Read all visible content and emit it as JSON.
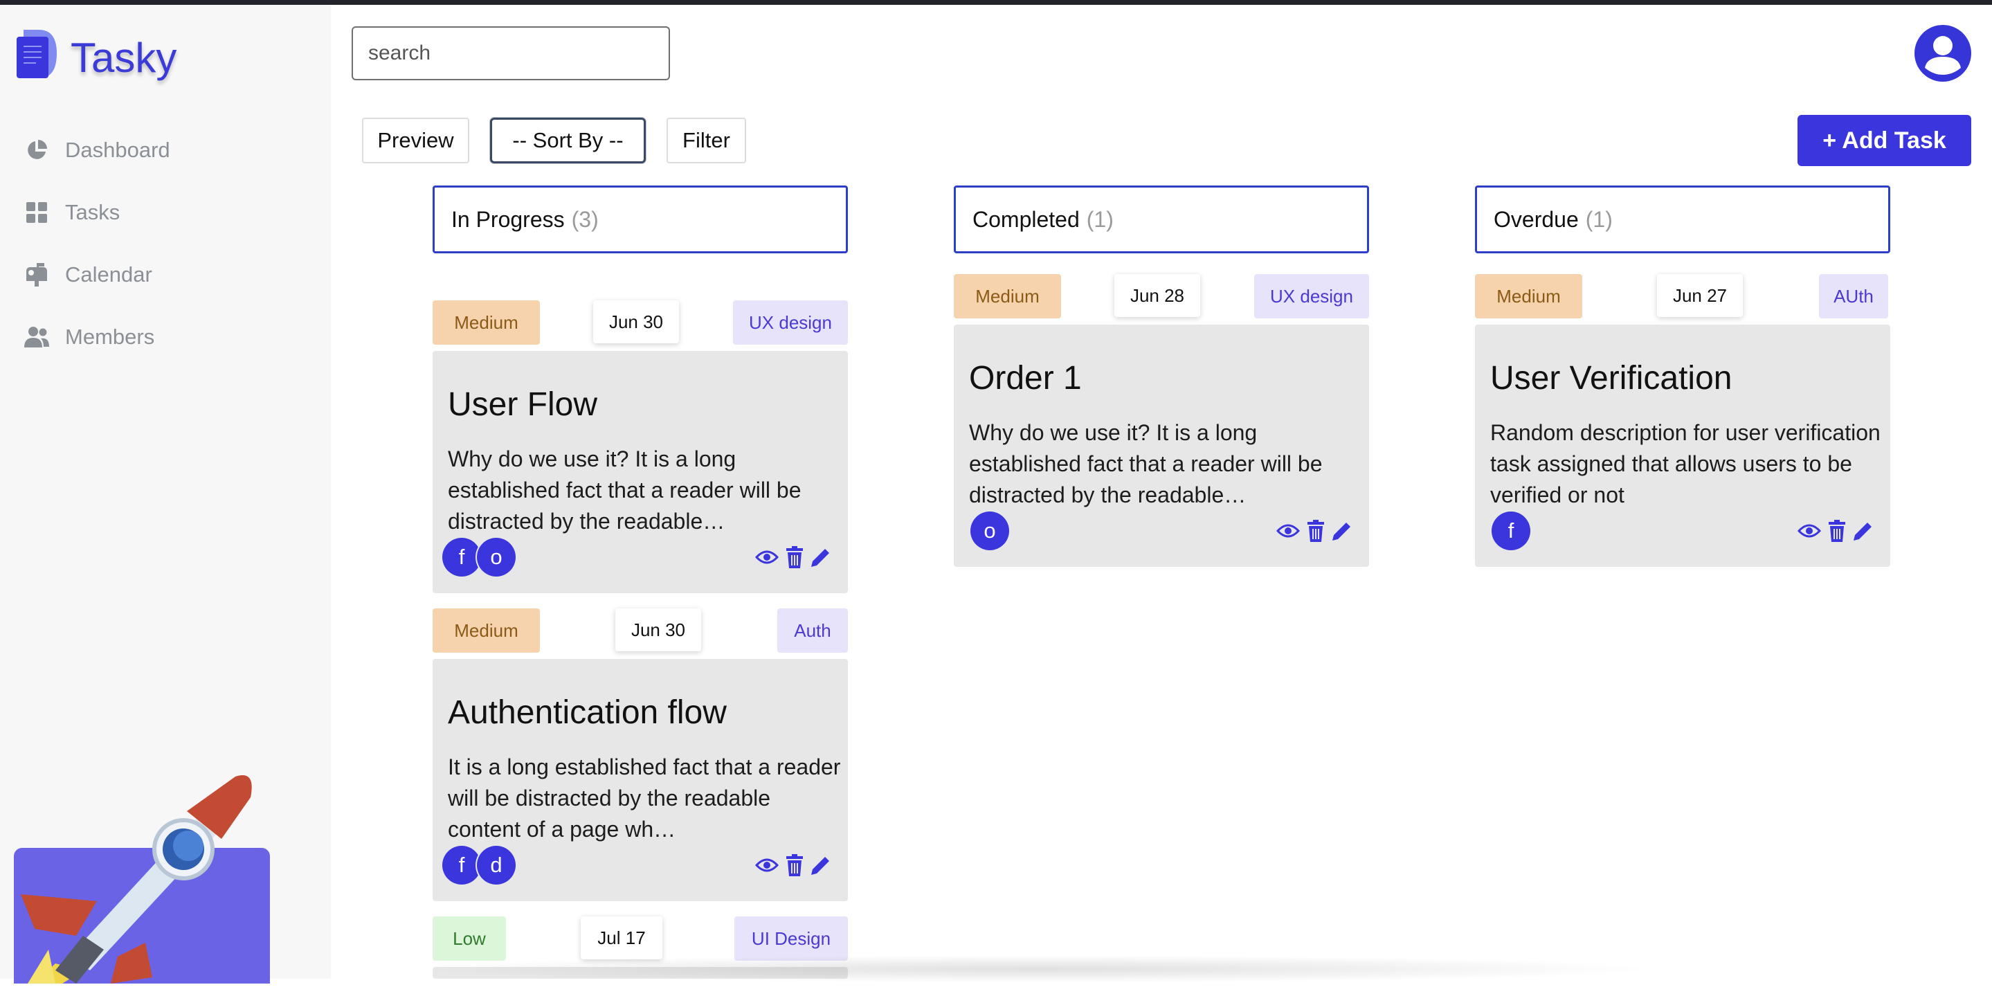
{
  "app": {
    "name": "Tasky"
  },
  "colors": {
    "accent": "#3a35dc",
    "sidebar_bg": "#f7f7f7",
    "card_bg": "#e7e7e7"
  },
  "sidebar": {
    "items": [
      {
        "label": "Dashboard",
        "icon": "pie-chart-icon"
      },
      {
        "label": "Tasks",
        "icon": "grid-icon"
      },
      {
        "label": "Calendar",
        "icon": "mailbox-icon"
      },
      {
        "label": "Members",
        "icon": "users-icon"
      }
    ]
  },
  "search": {
    "placeholder": "search",
    "value": ""
  },
  "toolbar": {
    "preview": "Preview",
    "sort": "-- Sort By --",
    "filter": "Filter",
    "add": "+ Add Task"
  },
  "columns": [
    {
      "name": "In Progress",
      "count": "(3)",
      "cards": [
        {
          "priority": "Medium",
          "date": "Jun 30",
          "category": "UX design",
          "title": "User Flow",
          "desc": "Why do we use it? It is a long established fact that a reader will be distracted by the readable…",
          "members": [
            "f",
            "o"
          ]
        },
        {
          "priority": "Medium",
          "date": "Jun 30",
          "category": "Auth",
          "title": "Authentication flow",
          "desc": "It is a long established fact that a reader will be distracted by the readable content of a page wh…",
          "members": [
            "f",
            "d"
          ]
        },
        {
          "priority": "Low",
          "date": "Jul 17",
          "category": "UI Design"
        }
      ]
    },
    {
      "name": "Completed",
      "count": "(1)",
      "cards": [
        {
          "priority": "Medium",
          "date": "Jun 28",
          "category": "UX design",
          "title": "Order 1",
          "desc": "Why do we use it? It is a long established fact that a reader will be distracted by the readable…",
          "members": [
            "o"
          ]
        }
      ]
    },
    {
      "name": "Overdue",
      "count": "(1)",
      "cards": [
        {
          "priority": "Medium",
          "date": "Jun 27",
          "category": "AUth",
          "title": "User Verification",
          "desc": "Random description for user verification task assigned that allows users to be verified or not",
          "members": [
            "f"
          ]
        }
      ]
    }
  ]
}
